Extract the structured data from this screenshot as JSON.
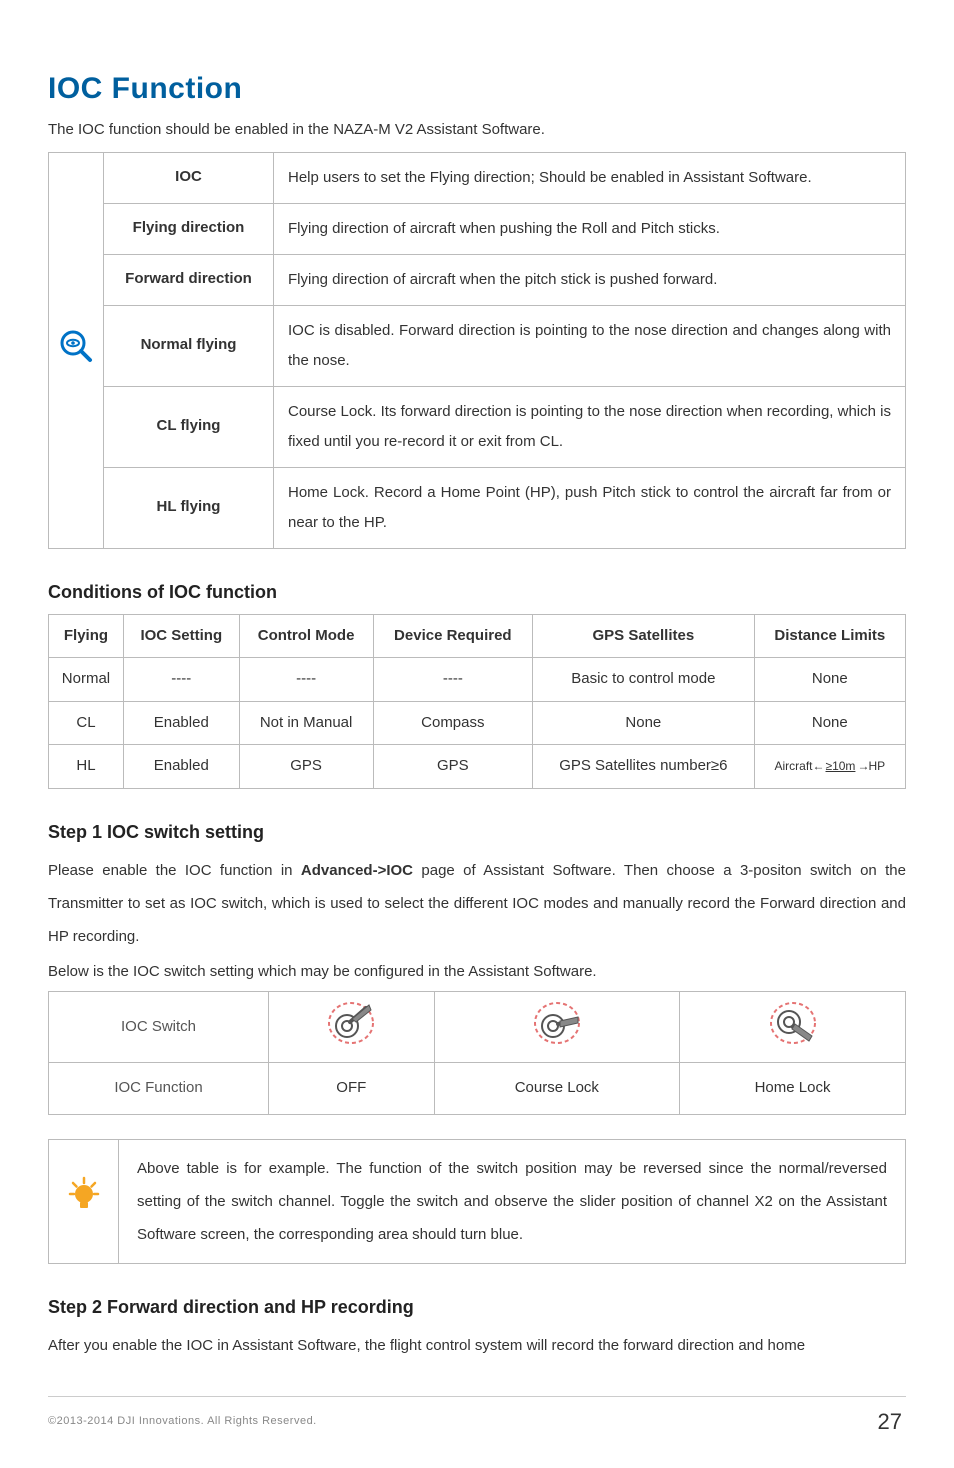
{
  "title": "IOC Function",
  "intro": "The IOC function should be enabled in the NAZA-M V2 Assistant Software.",
  "definitions": [
    {
      "label": "IOC",
      "desc": "Help users to set the Flying direction; Should be enabled in Assistant Software."
    },
    {
      "label": "Flying direction",
      "desc": "Flying direction of aircraft when pushing the Roll and Pitch sticks."
    },
    {
      "label": "Forward direction",
      "desc": "Flying direction of aircraft when the pitch stick is pushed forward."
    },
    {
      "label": "Normal flying",
      "desc": "IOC is disabled. Forward direction is pointing to the nose direction and changes along with the nose."
    },
    {
      "label": "CL flying",
      "desc": "Course Lock. Its forward direction is pointing to the nose direction when recording, which is fixed until you re-record it or exit from CL."
    },
    {
      "label": "HL flying",
      "desc": "Home Lock. Record a Home Point (HP), push Pitch stick to control the aircraft far from or near to the HP."
    }
  ],
  "conditions": {
    "heading": "Conditions of IOC function",
    "headers": [
      "Flying",
      "IOC Setting",
      "Control Mode",
      "Device Required",
      "GPS Satellites",
      "Distance Limits"
    ],
    "rows": [
      {
        "flying": "Normal",
        "ioc": "----",
        "mode": "----",
        "device": "----",
        "gps": "Basic to control mode",
        "dist": "None"
      },
      {
        "flying": "CL",
        "ioc": "Enabled",
        "mode": "Not in Manual",
        "device": "Compass",
        "gps": "None",
        "dist": "None"
      },
      {
        "flying": "HL",
        "ioc": "Enabled",
        "mode": "GPS",
        "device": "GPS",
        "gps": "GPS Satellites number≥6",
        "dist_left": "Aircraft",
        "dist_val": "≥10m",
        "dist_right": "HP"
      }
    ]
  },
  "step1": {
    "heading": "Step 1 IOC switch setting",
    "body_pre": "Please enable the IOC function in ",
    "body_bold": "Advanced->IOC",
    "body_post": " page of Assistant Software. Then choose a 3-positon switch on the Transmitter to set as IOC switch, which is used to select the different IOC modes and manually record the Forward direction and HP recording.",
    "caption": "Below is the IOC switch setting which may be configured in the Assistant Software.",
    "row_labels": {
      "switch": "IOC Switch",
      "func": "IOC Function"
    },
    "func_values": [
      "OFF",
      "Course Lock",
      "Home Lock"
    ]
  },
  "tip": "Above table is for example. The function of the switch position may be reversed since the normal/reversed setting of the switch channel. Toggle the switch and observe the slider position of channel X2 on the Assistant Software screen, the corresponding area should turn blue.",
  "step2": {
    "heading": "Step 2 Forward direction and HP recording",
    "body": "After you enable the IOC in Assistant Software, the flight control system will record the forward direction and home"
  },
  "footer": {
    "copyright": "©2013-2014 DJI Innovations. All Rights Reserved.",
    "page": "27"
  }
}
